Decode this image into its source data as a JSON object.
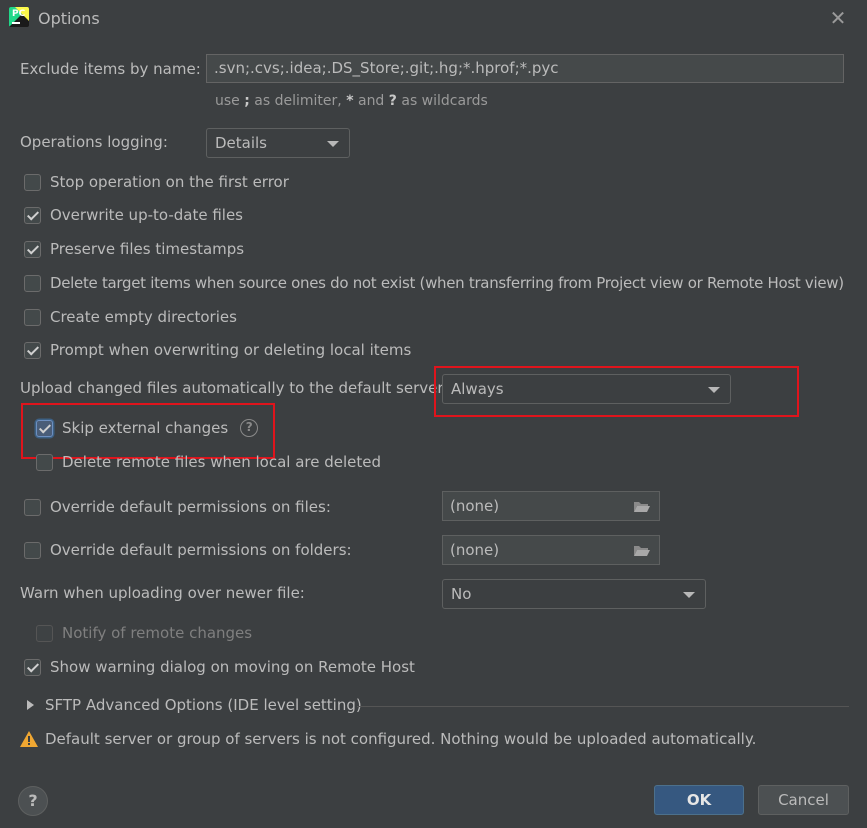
{
  "window": {
    "title": "Options",
    "logo_text": "PC"
  },
  "exclude": {
    "label": "Exclude items by name:",
    "value": ".svn;.cvs;.idea;.DS_Store;.git;.hg;*.hprof;*.pyc",
    "hint_use": "use",
    "hint_semicolon": ";",
    "hint_mid": "as delimiter,",
    "hint_star": "*",
    "hint_and": "and",
    "hint_q": "?",
    "hint_end": "as wildcards"
  },
  "logging": {
    "label": "Operations logging:",
    "value": "Details"
  },
  "checkboxes": {
    "stop_on_error": "Stop operation on the first error",
    "overwrite_uptodate": "Overwrite up-to-date files",
    "preserve_timestamps": "Preserve files timestamps",
    "delete_target": "Delete target items when source ones do not exist (when transferring from Project view or Remote Host view)",
    "create_empty_dirs": "Create empty directories",
    "prompt_overwrite": "Prompt when overwriting or deleting local items",
    "skip_external": "Skip external changes",
    "delete_remote": "Delete remote files when local are deleted",
    "override_files": "Override default permissions on files:",
    "override_folders": "Override default permissions on folders:",
    "notify_remote": "Notify of remote changes",
    "show_warning_dialog": "Show warning dialog on moving on Remote Host"
  },
  "upload": {
    "label": "Upload changed files automatically to the default server",
    "value": "Always"
  },
  "permissions": {
    "files_value": "(none)",
    "folders_value": "(none)"
  },
  "warn_newer": {
    "label": "Warn when uploading over newer file:",
    "value": "No"
  },
  "sftp": {
    "label": "SFTP Advanced Options (IDE level setting)"
  },
  "warning": {
    "text": "Default server or group of servers is not configured. Nothing would be uploaded automatically."
  },
  "buttons": {
    "help": "?",
    "ok": "OK",
    "cancel": "Cancel"
  },
  "colors": {
    "background": "#3c3f41",
    "highlight": "#e0141c",
    "ok_button": "#365880",
    "warning_icon": "#f0a732"
  }
}
